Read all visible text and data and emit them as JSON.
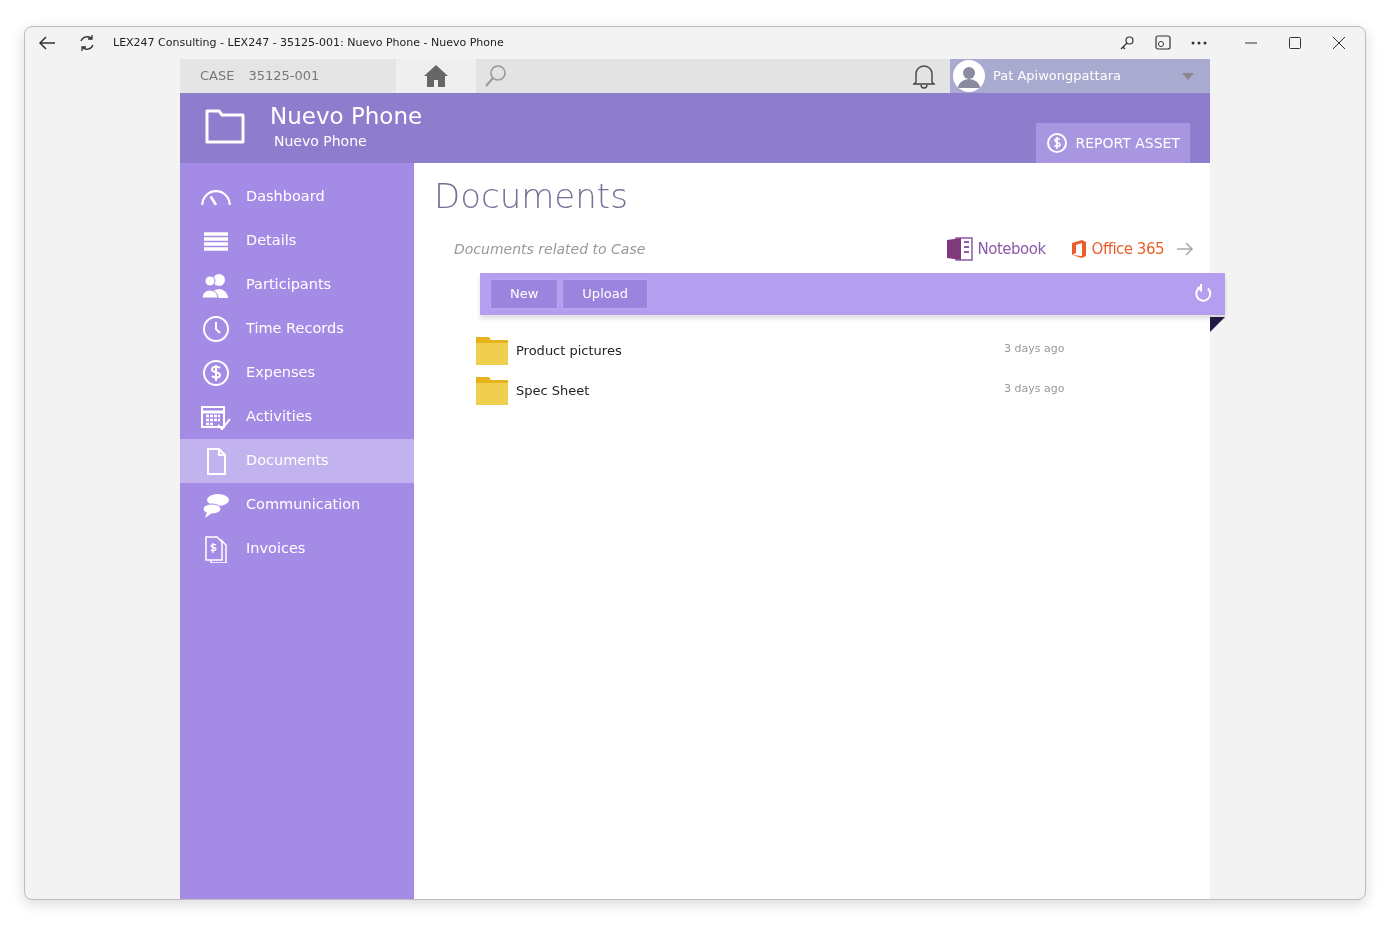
{
  "window": {
    "title": "LEX247 Consulting - LEX247 - 35125-001: Nuevo Phone - Nuevo Phone"
  },
  "topbar": {
    "case_label": "CASE",
    "case_number": "35125-001",
    "user": "Pat Apiwongpattara"
  },
  "header": {
    "title": "Nuevo Phone",
    "subtitle": "Nuevo Phone",
    "action": "REPORT ASSET"
  },
  "sidebar": {
    "items": [
      {
        "label": "Dashboard",
        "selected": false
      },
      {
        "label": "Details",
        "selected": false
      },
      {
        "label": "Participants",
        "selected": false
      },
      {
        "label": "Time Records",
        "selected": false
      },
      {
        "label": "Expenses",
        "selected": false
      },
      {
        "label": "Activities",
        "selected": false
      },
      {
        "label": "Documents",
        "selected": true
      },
      {
        "label": "Communication",
        "selected": false
      },
      {
        "label": "Invoices",
        "selected": false
      }
    ]
  },
  "content": {
    "title": "Documents",
    "subtitle": "Documents related to Case",
    "links": [
      {
        "label": "Notebook",
        "kind": "onenote"
      },
      {
        "label": "Office 365",
        "kind": "office"
      }
    ],
    "toolbar_buttons": [
      "New",
      "Upload"
    ],
    "files": [
      {
        "name": "Product pictures",
        "modified": "3 days ago"
      },
      {
        "name": "Spec Sheet",
        "modified": "3 days ago"
      }
    ]
  }
}
